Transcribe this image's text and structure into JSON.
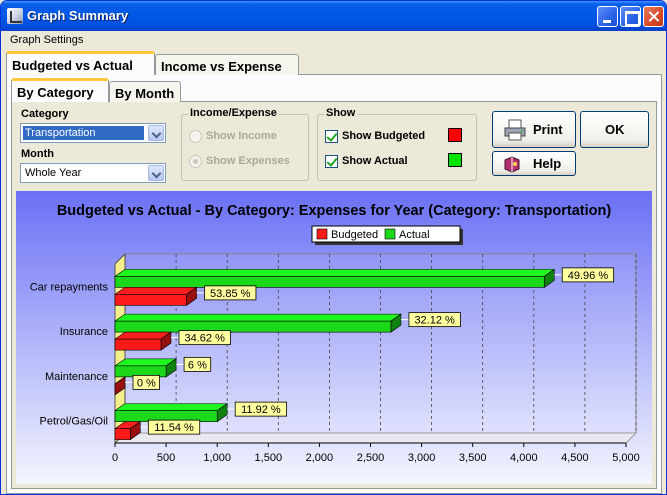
{
  "window": {
    "title": "Graph Summary"
  },
  "menu": {
    "settings": "Graph Settings"
  },
  "tabs": {
    "main": [
      "Budgeted vs Actual",
      "Income vs Expense"
    ],
    "sub": [
      "By Category",
      "By Month"
    ]
  },
  "filters": {
    "category_label": "Category",
    "category_value": "Transportation",
    "month_label": "Month",
    "month_value": "Whole Year"
  },
  "income_expense": {
    "title": "Income/Expense",
    "show_income": "Show Income",
    "show_expenses": "Show Expenses",
    "selected": "Show Expenses"
  },
  "show": {
    "title": "Show",
    "budgeted": "Show Budgeted",
    "budgeted_checked": true,
    "budgeted_color": "#ff0000",
    "actual": "Show Actual",
    "actual_checked": true,
    "actual_color": "#00e400"
  },
  "buttons": {
    "print": "Print",
    "ok": "OK",
    "help": "Help"
  },
  "colors": {
    "budgeted": "#ff1a1a",
    "actual": "#1bd81b",
    "label_bg": "#ffff9f",
    "plot_bg_top": "#6a70f4",
    "plot_bg_bottom": "#f4f6ff"
  },
  "chart_data": {
    "type": "bar",
    "orientation": "horizontal",
    "title": "Budgeted vs Actual - By Category: Expenses  for Year (Category: Transportation)",
    "categories": [
      "Car repayments",
      "Insurance",
      "Maintenance",
      "Petrol/Gas/Oil"
    ],
    "series": [
      {
        "name": "Budgeted",
        "values": [
          700,
          450,
          0,
          150
        ],
        "labels": [
          "53.85 %",
          "34.62 %",
          "0 %",
          "11.54 %"
        ]
      },
      {
        "name": "Actual",
        "values": [
          4200,
          2700,
          500,
          1000
        ],
        "labels": [
          "49.96 %",
          "32.12 %",
          "6 %",
          "11.92 %"
        ]
      }
    ],
    "xticks": [
      "0",
      "500",
      "1,000",
      "1,500",
      "2,000",
      "2,500",
      "3,000",
      "3,500",
      "4,000",
      "4,500",
      "5,000"
    ],
    "xlim": [
      0,
      5000
    ],
    "grid": true,
    "legend": "top-center"
  }
}
